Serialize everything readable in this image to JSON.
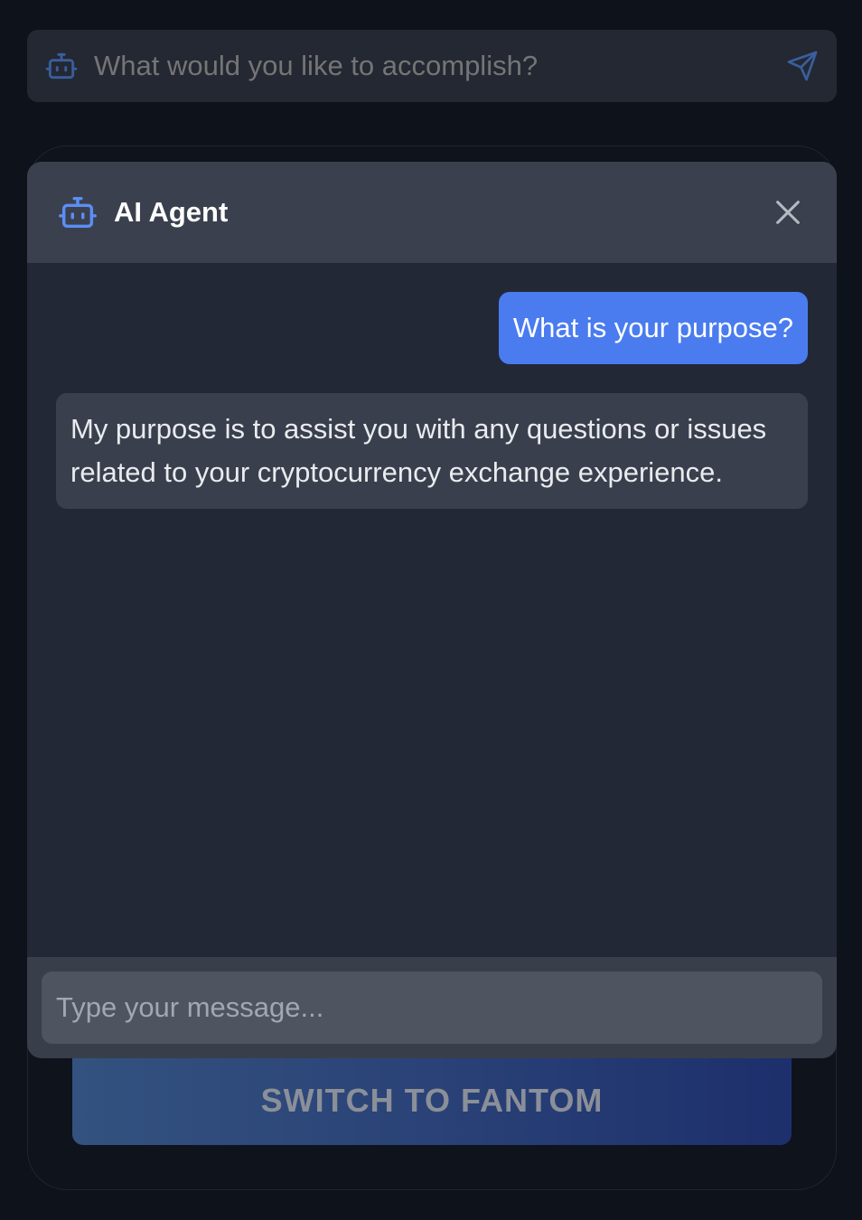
{
  "topbar": {
    "placeholder": "What would you like to accomplish?",
    "icon": "robot-icon",
    "send_icon": "send-icon"
  },
  "background": {
    "switch_label": "SWITCH TO FANTOM"
  },
  "chat": {
    "title": "AI Agent",
    "header_icon": "robot-icon",
    "close_icon": "close-icon",
    "messages": [
      {
        "role": "user",
        "text": "What is your purpose?"
      },
      {
        "role": "agent",
        "text": "My purpose is to assist you with any questions or issues related to your cryptocurrency exchange experience."
      }
    ],
    "input_placeholder": "Type your message..."
  },
  "colors": {
    "accent": "#4a7cf0",
    "page_bg": "#0e121b",
    "panel_bg": "#222836",
    "header_bg": "#3b404e"
  }
}
